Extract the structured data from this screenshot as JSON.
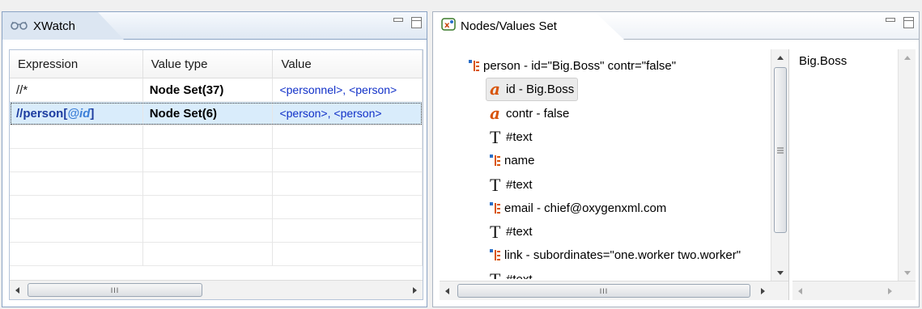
{
  "xwatch": {
    "title": "XWatch",
    "icon": "glasses-icon",
    "columns": [
      "Expression",
      "Value type",
      "Value"
    ],
    "rows": [
      {
        "expression": "//*",
        "value_type": "Node Set(37)",
        "value": "<personnel>, <person>",
        "selected": false
      },
      {
        "expression_prefix": "//person[",
        "expression_attr": "@id",
        "expression_suffix": "]",
        "value_type": "Node Set(6)",
        "value": "<person>, <person>",
        "selected": true
      }
    ],
    "empty_rows": 6,
    "hscroll_grip": "III"
  },
  "nodes": {
    "title": "Nodes/Values Set",
    "icon": "node-set-icon",
    "tree": [
      {
        "kind": "element",
        "label": "person - id=\"Big.Boss\" contr=\"false\"",
        "level": 0
      },
      {
        "kind": "attribute",
        "label": "id - Big.Boss",
        "level": 1,
        "selected": true
      },
      {
        "kind": "attribute",
        "label": "contr - false",
        "level": 1
      },
      {
        "kind": "text",
        "label": "#text",
        "level": 1
      },
      {
        "kind": "element",
        "label": "name",
        "level": 1
      },
      {
        "kind": "text",
        "label": "#text",
        "level": 1
      },
      {
        "kind": "element",
        "label": "email - chief@oxygenxml.com",
        "level": 1
      },
      {
        "kind": "text",
        "label": "#text",
        "level": 1
      },
      {
        "kind": "element",
        "label": "link - subordinates=\"one.worker two.worker\"",
        "level": 1
      },
      {
        "kind": "text",
        "label": "#text",
        "level": 1
      }
    ],
    "value": "Big.Boss",
    "hscroll_grip": "III"
  },
  "colors": {
    "expression_blue": "#1c3ca0",
    "attr_blue": "#3c7fd8",
    "value_blue": "#1030c8",
    "attribute_icon": "#d8540a",
    "selection": "#d9ecfb"
  }
}
